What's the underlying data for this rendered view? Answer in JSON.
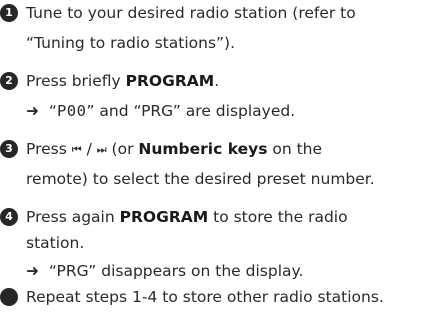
{
  "steps": [
    {
      "marker": "1",
      "line1": "Tune to your desired radio station (refer to",
      "line2": "“Tuning to radio stations”)."
    },
    {
      "marker": "2",
      "pre": "Press briefly ",
      "bold": "PROGRAM",
      "post": ".",
      "result_arrow": "➜",
      "result_q1": " “",
      "result_lcd": "P00",
      "result_rest": "” and “PRG” are displayed."
    },
    {
      "marker": "3",
      "pre": "Press ",
      "prev_glyph": "⏮",
      "slash": " / ",
      "next_glyph": "⏭",
      "mid": " (or ",
      "bold": "Numberic keys",
      "post": " on the",
      "line2": "remote) to select the desired preset number."
    },
    {
      "marker": "4",
      "pre": "Press again ",
      "bold": "PROGRAM",
      "post": " to store the radio",
      "line2": "station.",
      "result_arrow": "➜",
      "result_text": " “PRG” disappears on the display."
    }
  ],
  "note": {
    "marker": "●",
    "text": "Repeat steps 1-4 to store other radio stations."
  }
}
